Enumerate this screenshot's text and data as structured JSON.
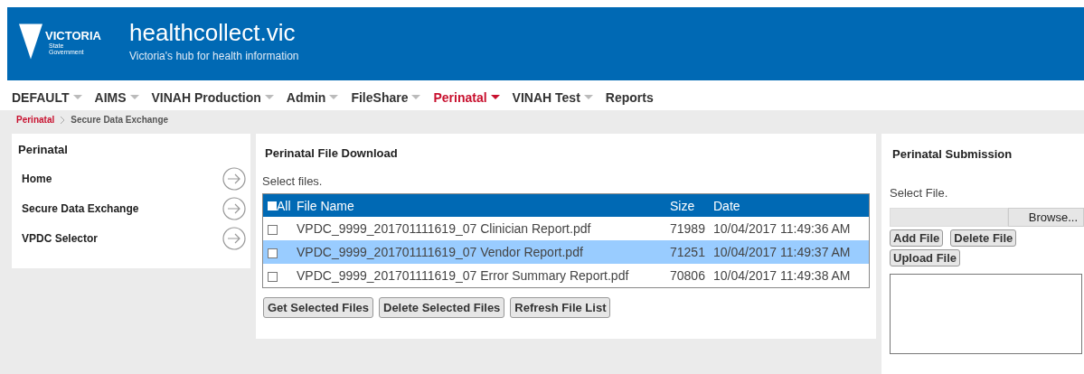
{
  "header": {
    "logo": {
      "word": "VICTORIA",
      "line1": "State",
      "line2": "Government"
    },
    "title": "healthcollect.vic",
    "subtitle": "Victoria's hub for health information"
  },
  "nav": [
    {
      "label": "DEFAULT",
      "has_menu": true,
      "selected": false
    },
    {
      "label": "AIMS",
      "has_menu": true,
      "selected": false
    },
    {
      "label": "VINAH Production",
      "has_menu": true,
      "selected": false
    },
    {
      "label": "Admin",
      "has_menu": true,
      "selected": false
    },
    {
      "label": "FileShare",
      "has_menu": true,
      "selected": false
    },
    {
      "label": "Perinatal",
      "has_menu": true,
      "selected": true
    },
    {
      "label": "VINAH Test",
      "has_menu": true,
      "selected": false
    },
    {
      "label": "Reports",
      "has_menu": false,
      "selected": false
    }
  ],
  "breadcrumb": [
    "Perinatal",
    "Secure Data Exchange"
  ],
  "sidebar": {
    "title": "Perinatal",
    "items": [
      {
        "label": "Home"
      },
      {
        "label": "Secure Data Exchange"
      },
      {
        "label": "VPDC Selector"
      }
    ]
  },
  "download": {
    "title": "Perinatal File Download",
    "hint": "Select files.",
    "table": {
      "all_label": "All",
      "all_checked": false,
      "columns": [
        "File Name",
        "Size",
        "Date"
      ],
      "rows": [
        {
          "checked": false,
          "selected": false,
          "cells": [
            "VPDC_9999_201701111619_07 Clinician Report.pdf",
            "71989",
            "10/04/2017 11:49:36 AM"
          ]
        },
        {
          "checked": false,
          "selected": true,
          "cells": [
            "VPDC_9999_201701111619_07 Vendor Report.pdf",
            "71251",
            "10/04/2017 11:49:37 AM"
          ]
        },
        {
          "checked": false,
          "selected": false,
          "cells": [
            "VPDC_9999_201701111619_07 Error Summary Report.pdf",
            "70806",
            "10/04/2017 11:49:38 AM"
          ]
        }
      ]
    },
    "buttons": [
      "Get Selected Files",
      "Delete Selected Files",
      "Refresh File List"
    ]
  },
  "submission": {
    "title": "Perinatal Submission",
    "hint": "Select File.",
    "browse": "Browse...",
    "buttons": [
      [
        "Add File",
        "Delete File"
      ],
      [
        "Upload File"
      ]
    ]
  }
}
